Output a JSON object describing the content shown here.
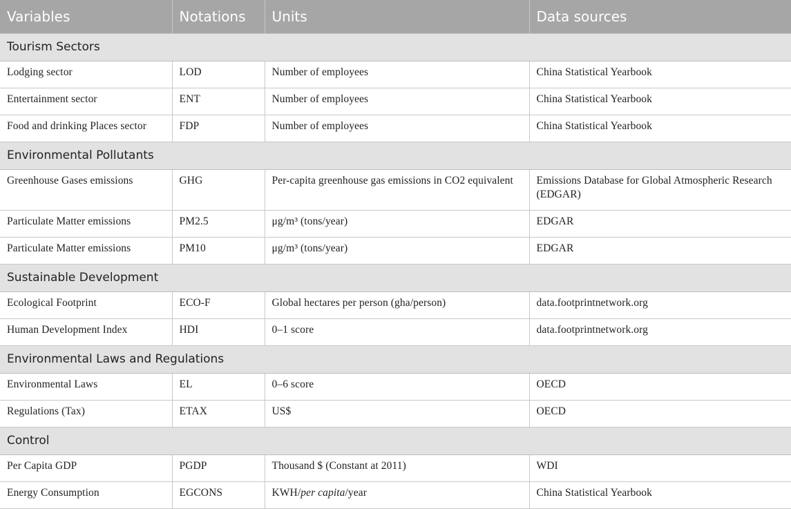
{
  "table": {
    "headers": [
      "Variables",
      "Notations",
      "Units",
      "Data sources"
    ],
    "sections": [
      {
        "title": "Tourism Sectors",
        "rows": [
          {
            "variable": "Lodging sector",
            "notation": "LOD",
            "units": "Number of employees",
            "source": "China Statistical Yearbook"
          },
          {
            "variable": "Entertainment sector",
            "notation": "ENT",
            "units": "Number of employees",
            "source": "China Statistical Yearbook"
          },
          {
            "variable": "Food and drinking Places sector",
            "notation": "FDP",
            "units": "Number of employees",
            "source": "China Statistical Yearbook"
          }
        ]
      },
      {
        "title": "Environmental Pollutants",
        "rows": [
          {
            "variable": "Greenhouse Gases emissions",
            "notation": "GHG",
            "units": "Per-capita greenhouse gas emissions in CO2 equivalent",
            "source": "Emissions Database for Global Atmospheric Research (EDGAR)"
          },
          {
            "variable": "Particulate Matter emissions",
            "notation": "PM2.5",
            "units": "μg/m³ (tons/year)",
            "source": "EDGAR"
          },
          {
            "variable": "Particulate Matter emissions",
            "notation": "PM10",
            "units": "μg/m³ (tons/year)",
            "source": "EDGAR"
          }
        ]
      },
      {
        "title": "Sustainable Development",
        "rows": [
          {
            "variable": "Ecological Footprint",
            "notation": "ECO-F",
            "units": "Global hectares per person (gha/person)",
            "source": "data.footprintnetwork.org"
          },
          {
            "variable": "Human Development Index",
            "notation": "HDI",
            "units": "0–1 score",
            "source": "data.footprintnetwork.org"
          }
        ]
      },
      {
        "title": "Environmental Laws and Regulations",
        "rows": [
          {
            "variable": "Environmental Laws",
            "notation": "EL",
            "units": "0–6 score",
            "source": "OECD"
          },
          {
            "variable": "Regulations (Tax)",
            "notation": "ETAX",
            "units": "US$",
            "source": "OECD"
          }
        ]
      },
      {
        "title": "Control",
        "rows": [
          {
            "variable": "Per Capita GDP",
            "notation": "PGDP",
            "units": "Thousand $ (Constant at 2011)",
            "source": "WDI"
          },
          {
            "variable": "Energy Consumption",
            "notation": "EGCONS",
            "units_parts": [
              "KWH/",
              "per capita",
              "/year"
            ],
            "source": "China Statistical Yearbook"
          }
        ]
      }
    ]
  },
  "colors": {
    "header_bg": "#a6a6a6",
    "section_bg": "#e2e2e2",
    "border": "#c8c8c8"
  }
}
